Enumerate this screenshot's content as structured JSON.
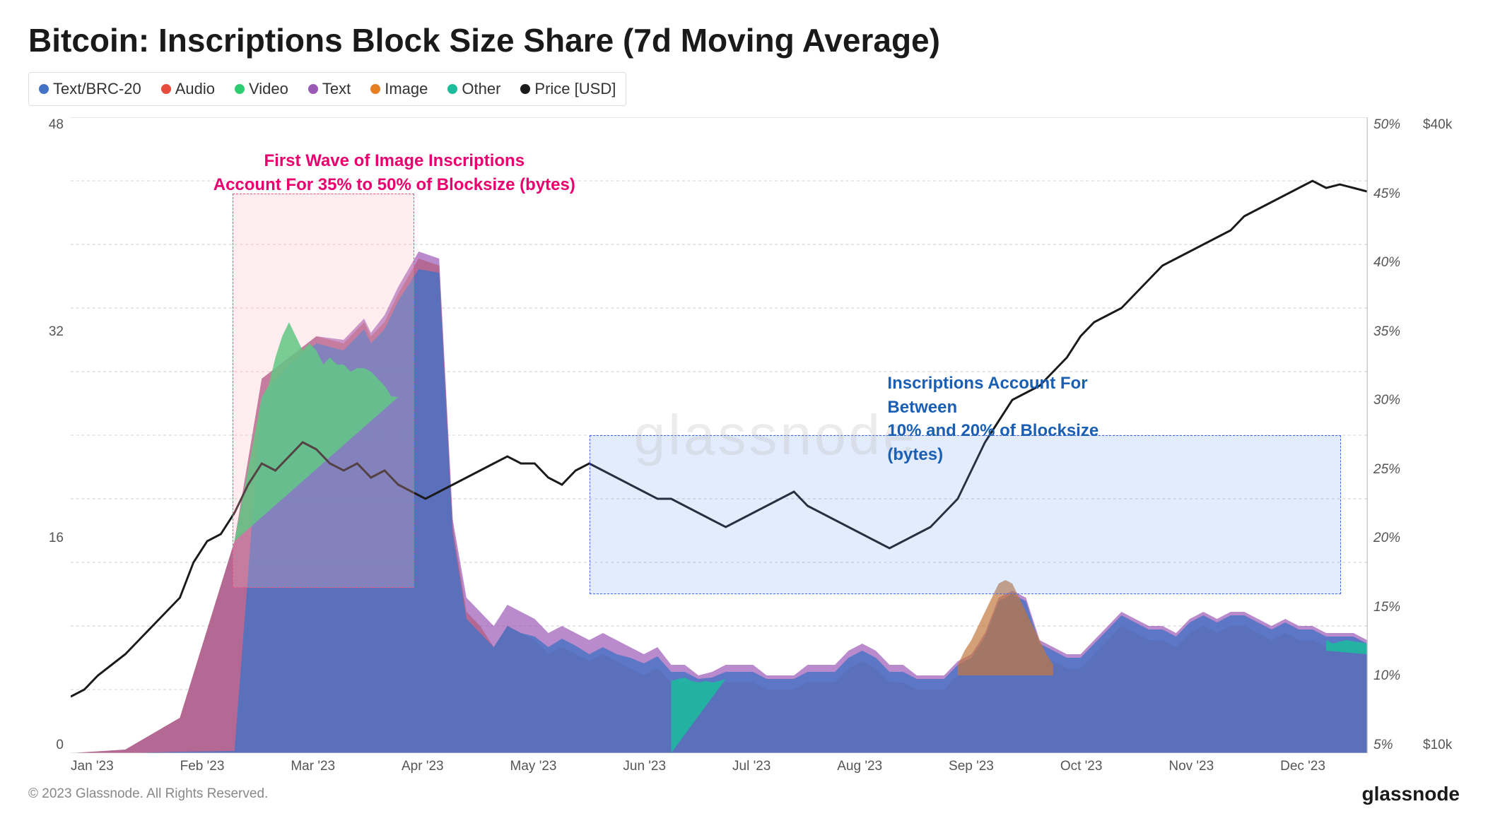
{
  "title": "Bitcoin: Inscriptions Block Size Share (7d Moving Average)",
  "legend": {
    "items": [
      {
        "label": "Text/BRC-20",
        "color": "#4472c4",
        "type": "dot"
      },
      {
        "label": "Audio",
        "color": "#e74c3c",
        "type": "dot"
      },
      {
        "label": "Video",
        "color": "#2ecc71",
        "type": "dot"
      },
      {
        "label": "Text",
        "color": "#9b59b6",
        "type": "dot"
      },
      {
        "label": "Image",
        "color": "#e67e22",
        "type": "dot"
      },
      {
        "label": "Other",
        "color": "#1abc9c",
        "type": "dot"
      },
      {
        "label": "Price [USD]",
        "color": "#1a1a1a",
        "type": "dot"
      }
    ]
  },
  "y_axis_left": [
    "0",
    "16",
    "32",
    "48"
  ],
  "y_axis_pct": [
    "5%",
    "10%",
    "15%",
    "20%",
    "25%",
    "30%",
    "35%",
    "40%",
    "45%",
    "50%"
  ],
  "y_axis_price": [
    "$10k",
    "$40k"
  ],
  "x_axis": [
    "Jan '23",
    "Feb '23",
    "Mar '23",
    "Apr '23",
    "May '23",
    "Jun '23",
    "Jul '23",
    "Aug '23",
    "Sep '23",
    "Oct '23",
    "Nov '23",
    "Dec '23"
  ],
  "annotation_pink": {
    "line1": "First Wave of Image Inscriptions",
    "line2": "Account For 35% to 50% of Blocksize (bytes)"
  },
  "annotation_blue": {
    "line1": "Inscriptions Account For Between",
    "line2": "10% and 20% of Blocksize (bytes)"
  },
  "watermark": "glassnode",
  "footer": {
    "copyright": "© 2023 Glassnode. All Rights Reserved.",
    "logo": "glassnode"
  }
}
